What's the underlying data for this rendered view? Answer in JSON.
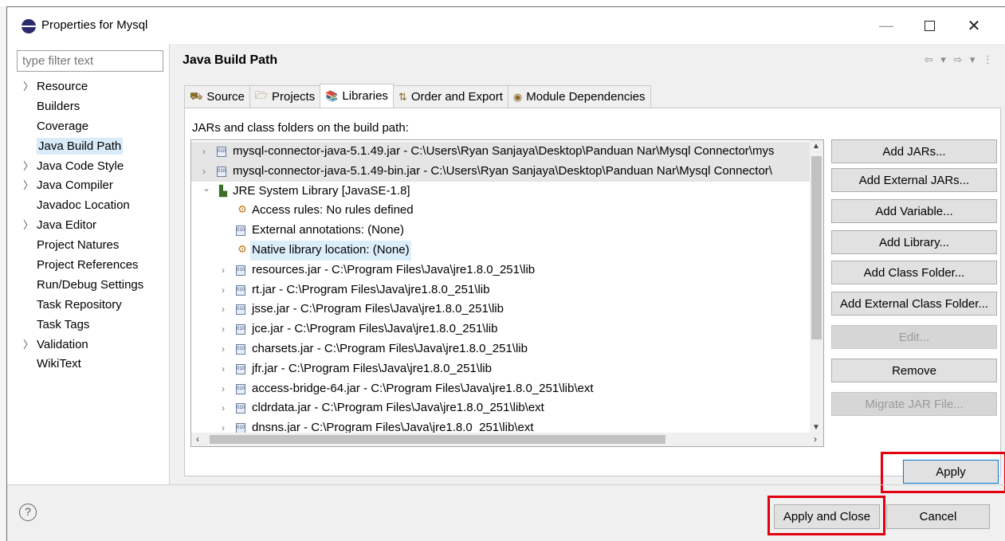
{
  "window": {
    "title": "Properties for Mysql",
    "minimize_glyph": "—",
    "close_glyph": "✕"
  },
  "filter": {
    "placeholder": "type filter text"
  },
  "nav": {
    "items": [
      {
        "label": "Resource",
        "expandable": true
      },
      {
        "label": "Builders",
        "expandable": false
      },
      {
        "label": "Coverage",
        "expandable": false
      },
      {
        "label": "Java Build Path",
        "expandable": false,
        "selected": true
      },
      {
        "label": "Java Code Style",
        "expandable": true
      },
      {
        "label": "Java Compiler",
        "expandable": true
      },
      {
        "label": "Javadoc Location",
        "expandable": false
      },
      {
        "label": "Java Editor",
        "expandable": true
      },
      {
        "label": "Project Natures",
        "expandable": false
      },
      {
        "label": "Project References",
        "expandable": false
      },
      {
        "label": "Run/Debug Settings",
        "expandable": false
      },
      {
        "label": "Task Repository",
        "expandable": false
      },
      {
        "label": "Task Tags",
        "expandable": false
      },
      {
        "label": "Validation",
        "expandable": true
      },
      {
        "label": "WikiText",
        "expandable": false
      }
    ]
  },
  "page": {
    "title": "Java Build Path",
    "nav_arrows": "⇦ ▾ ⇨ ▾ ⋮"
  },
  "tabs": [
    {
      "label": "Source",
      "icon": "source-folder-icon",
      "glyph": "⛟"
    },
    {
      "label": "Projects",
      "icon": "projects-folder-icon",
      "glyph": "🗁"
    },
    {
      "label": "Libraries",
      "icon": "libraries-icon",
      "glyph": "📚",
      "active": true
    },
    {
      "label": "Order and Export",
      "icon": "order-export-icon",
      "glyph": "⇅"
    },
    {
      "label": "Module Dependencies",
      "icon": "module-icon",
      "glyph": "◉"
    }
  ],
  "libraries": {
    "label": "JARs and class folders on the build path:",
    "rows": [
      {
        "indent": 0,
        "expander": "›",
        "icon": "jar",
        "text": "mysql-connector-java-5.1.49.jar - C:\\Users\\Ryan Sanjaya\\Desktop\\Panduan Nar\\Mysql Connector\\mys",
        "highlight": true
      },
      {
        "indent": 0,
        "expander": "›",
        "icon": "jar",
        "text": "mysql-connector-java-5.1.49-bin.jar - C:\\Users\\Ryan Sanjaya\\Desktop\\Panduan Nar\\Mysql Connector\\",
        "highlight": true
      },
      {
        "indent": 0,
        "expander": "⌄",
        "icon": "lib",
        "text": "JRE System Library [JavaSE-1.8]"
      },
      {
        "indent": 1,
        "expander": "",
        "icon": "gear",
        "text": "Access rules: No rules defined"
      },
      {
        "indent": 1,
        "expander": "",
        "icon": "jar",
        "text": "External annotations: (None)"
      },
      {
        "indent": 1,
        "expander": "",
        "icon": "gear",
        "text": "Native library location: (None)",
        "selected": true
      },
      {
        "indent": 1,
        "expander": "›",
        "icon": "jar",
        "text": "resources.jar - C:\\Program Files\\Java\\jre1.8.0_251\\lib"
      },
      {
        "indent": 1,
        "expander": "›",
        "icon": "jar",
        "text": "rt.jar - C:\\Program Files\\Java\\jre1.8.0_251\\lib"
      },
      {
        "indent": 1,
        "expander": "›",
        "icon": "jar",
        "text": "jsse.jar - C:\\Program Files\\Java\\jre1.8.0_251\\lib"
      },
      {
        "indent": 1,
        "expander": "›",
        "icon": "jar",
        "text": "jce.jar - C:\\Program Files\\Java\\jre1.8.0_251\\lib"
      },
      {
        "indent": 1,
        "expander": "›",
        "icon": "jar",
        "text": "charsets.jar - C:\\Program Files\\Java\\jre1.8.0_251\\lib"
      },
      {
        "indent": 1,
        "expander": "›",
        "icon": "jar",
        "text": "jfr.jar - C:\\Program Files\\Java\\jre1.8.0_251\\lib"
      },
      {
        "indent": 1,
        "expander": "›",
        "icon": "jar",
        "text": "access-bridge-64.jar - C:\\Program Files\\Java\\jre1.8.0_251\\lib\\ext"
      },
      {
        "indent": 1,
        "expander": "›",
        "icon": "jar",
        "text": "cldrdata.jar - C:\\Program Files\\Java\\jre1.8.0_251\\lib\\ext"
      },
      {
        "indent": 1,
        "expander": "›",
        "icon": "jar",
        "text": "dnsns.jar - C:\\Program Files\\Java\\jre1.8.0_251\\lib\\ext"
      }
    ]
  },
  "side_buttons": [
    {
      "label": "Add JARs...",
      "enabled": true
    },
    {
      "label": "Add External JARs...",
      "enabled": true
    },
    {
      "label": "Add Variable...",
      "enabled": true
    },
    {
      "label": "Add Library...",
      "enabled": true
    },
    {
      "label": "Add Class Folder...",
      "enabled": true
    },
    {
      "label": "Add External Class Folder...",
      "enabled": true
    },
    {
      "label": "Edit...",
      "enabled": false
    },
    {
      "label": "Remove",
      "enabled": true
    },
    {
      "label": "Migrate JAR File...",
      "enabled": false
    }
  ],
  "buttons": {
    "apply": "Apply",
    "apply_and_close": "Apply and Close",
    "cancel": "Cancel",
    "help": "?"
  },
  "colors": {
    "highlight_box": "#e2000f",
    "selection": "#d9ebf9",
    "focus_border": "#0078d7"
  }
}
